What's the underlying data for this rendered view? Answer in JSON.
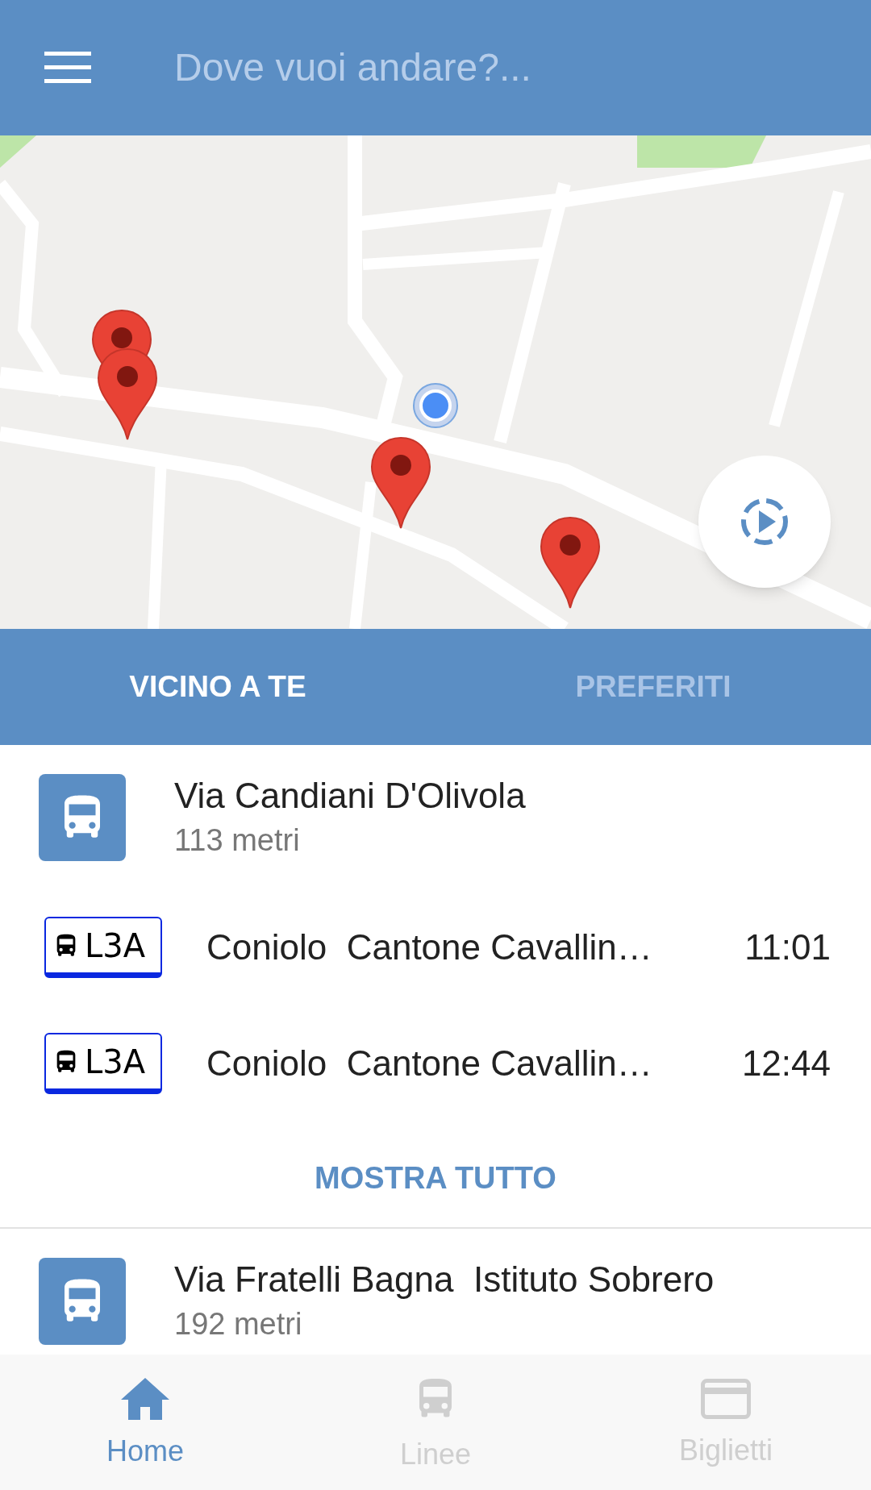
{
  "header": {
    "placeholder": "Dove vuoi andare?..."
  },
  "tabs": [
    {
      "label": "VICINO A TE",
      "selected": true
    },
    {
      "label": "PREFERITI",
      "selected": false
    }
  ],
  "stops": [
    {
      "name": "Via Candiani D'Olivola",
      "distance": "113 metri",
      "departures": [
        {
          "line": "L3A",
          "destination": "Coniolo  Cantone Cavallin…",
          "time": "11:01"
        },
        {
          "line": "L3A",
          "destination": "Coniolo  Cantone Cavallin…",
          "time": "12:44"
        }
      ],
      "action": "MOSTRA TUTTO"
    },
    {
      "name": "Via Fratelli Bagna  Istituto Sobrero",
      "distance": "192 metri"
    }
  ],
  "bottom_nav": [
    {
      "label": "Home",
      "selected": true
    },
    {
      "label": "Linee",
      "selected": false
    },
    {
      "label": "Biglietti",
      "selected": false
    }
  ]
}
